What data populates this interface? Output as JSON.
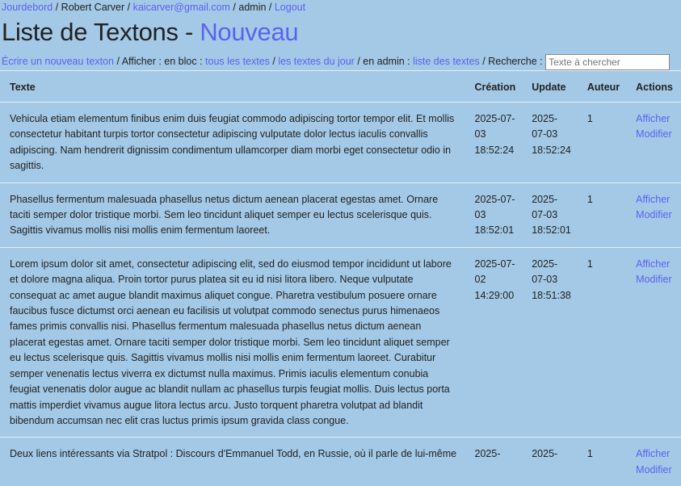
{
  "topnav": {
    "home": "Jourdebord",
    "user": "Robert Carver",
    "email": "kaicarver@gmail.com",
    "role": "admin",
    "logout": "Logout"
  },
  "title": {
    "main": "Liste de Textons",
    "sep": " - ",
    "new": "Nouveau"
  },
  "toolbar": {
    "write": "Écrire un nouveau texton",
    "afficher": " / Afficher : en bloc : ",
    "all": "tous les textes",
    "sep1": " / ",
    "today": "les textes du jour",
    "admin": " / en admin : ",
    "list": "liste des textes",
    "search_label": " / Recherche : ",
    "search_placeholder": "Texte à chercher"
  },
  "table": {
    "headers": [
      "Texte",
      "Création",
      "Update",
      "Auteur",
      "Actions"
    ],
    "rows": [
      {
        "text": "Vehicula etiam elementum finibus enim duis feugiat commodo adipiscing tortor tempor elit. Et mollis consectetur habitant turpis tortor consectetur adipiscing vulputate dolor lectus iaculis convallis adipiscing. Nam hendrerit dignissim condimentum ullamcorper diam morbi eget consectetur odio in sagittis.",
        "created": "2025-07-03 18:52:24",
        "updated": "2025-07-03 18:52:24",
        "author": "1",
        "show": "Afficher",
        "edit": "Modifier"
      },
      {
        "text": "Phasellus fermentum malesuada phasellus netus dictum aenean placerat egestas amet. Ornare taciti semper dolor tristique morbi. Sem leo tincidunt aliquet semper eu lectus scelerisque quis. Sagittis vivamus mollis nisi mollis enim fermentum laoreet.",
        "created": "2025-07-03 18:52:01",
        "updated": "2025-07-03 18:52:01",
        "author": "1",
        "show": "Afficher",
        "edit": "Modifier"
      },
      {
        "text": "Lorem ipsum dolor sit amet, consectetur adipiscing elit, sed do eiusmod tempor incididunt ut labore et dolore magna aliqua. Proin tortor purus platea sit eu id nisi litora libero. Neque vulputate consequat ac amet augue blandit maximus aliquet congue. Pharetra vestibulum posuere ornare faucibus fusce dictumst orci aenean eu facilisis ut volutpat commodo senectus purus himenaeos fames primis convallis nisi. Phasellus fermentum malesuada phasellus netus dictum aenean placerat egestas amet. Ornare taciti semper dolor tristique morbi. Sem leo tincidunt aliquet semper eu lectus scelerisque quis. Sagittis vivamus mollis nisi mollis enim fermentum laoreet. Curabitur semper venenatis lectus viverra ex dictumst nulla maximus. Primis iaculis elementum conubia feugiat venenatis dolor augue ac blandit nullam ac phasellus turpis feugiat mollis. Duis lectus porta mattis imperdiet vivamus augue litora lectus arcu. Justo torquent pharetra volutpat ad blandit bibendum accumsan nec elit cras luctus primis ipsum gravida class congue.",
        "created": "2025-07-02 14:29:00",
        "updated": "2025-07-03 18:51:38",
        "author": "1",
        "show": "Afficher",
        "edit": "Modifier"
      },
      {
        "text": "Deux liens intéressants via Stratpol : Discours d'Emmanuel Todd, en Russie, où il parle de lui-même",
        "created": "2025-",
        "updated": "2025-",
        "author": "1",
        "show": "Afficher",
        "edit": "Modifier"
      }
    ]
  }
}
